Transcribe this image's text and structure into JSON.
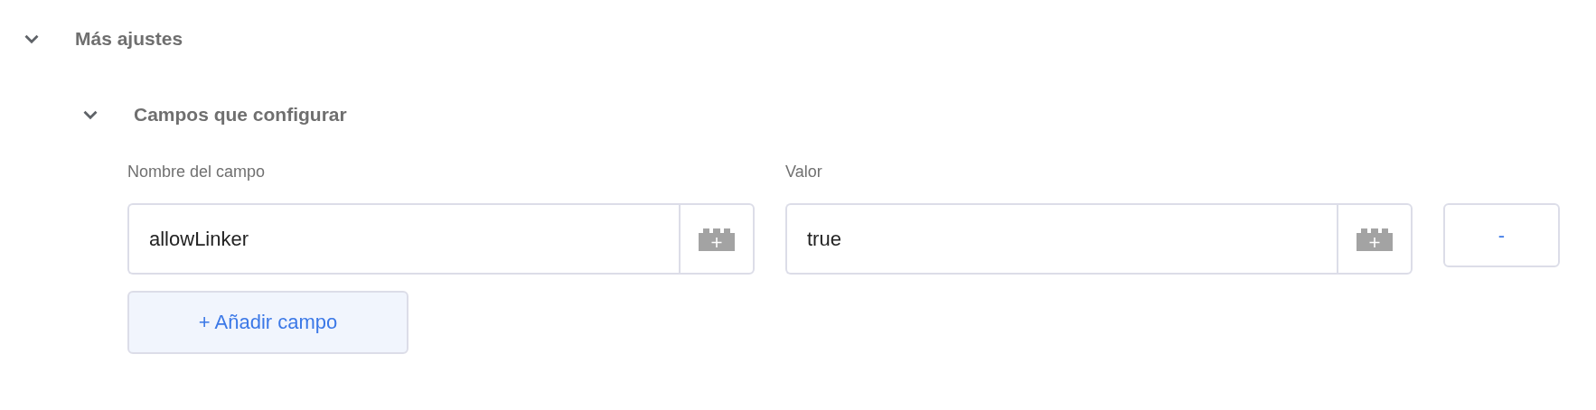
{
  "section": {
    "title": "Más ajustes",
    "expanded": true,
    "subsection": {
      "title": "Campos que configurar",
      "expanded": true,
      "columns": [
        "Nombre del campo",
        "Valor"
      ],
      "rows": [
        {
          "name": "allowLinker",
          "value": "true",
          "remove": "-"
        }
      ],
      "add_button": "+ Añadir campo"
    }
  }
}
